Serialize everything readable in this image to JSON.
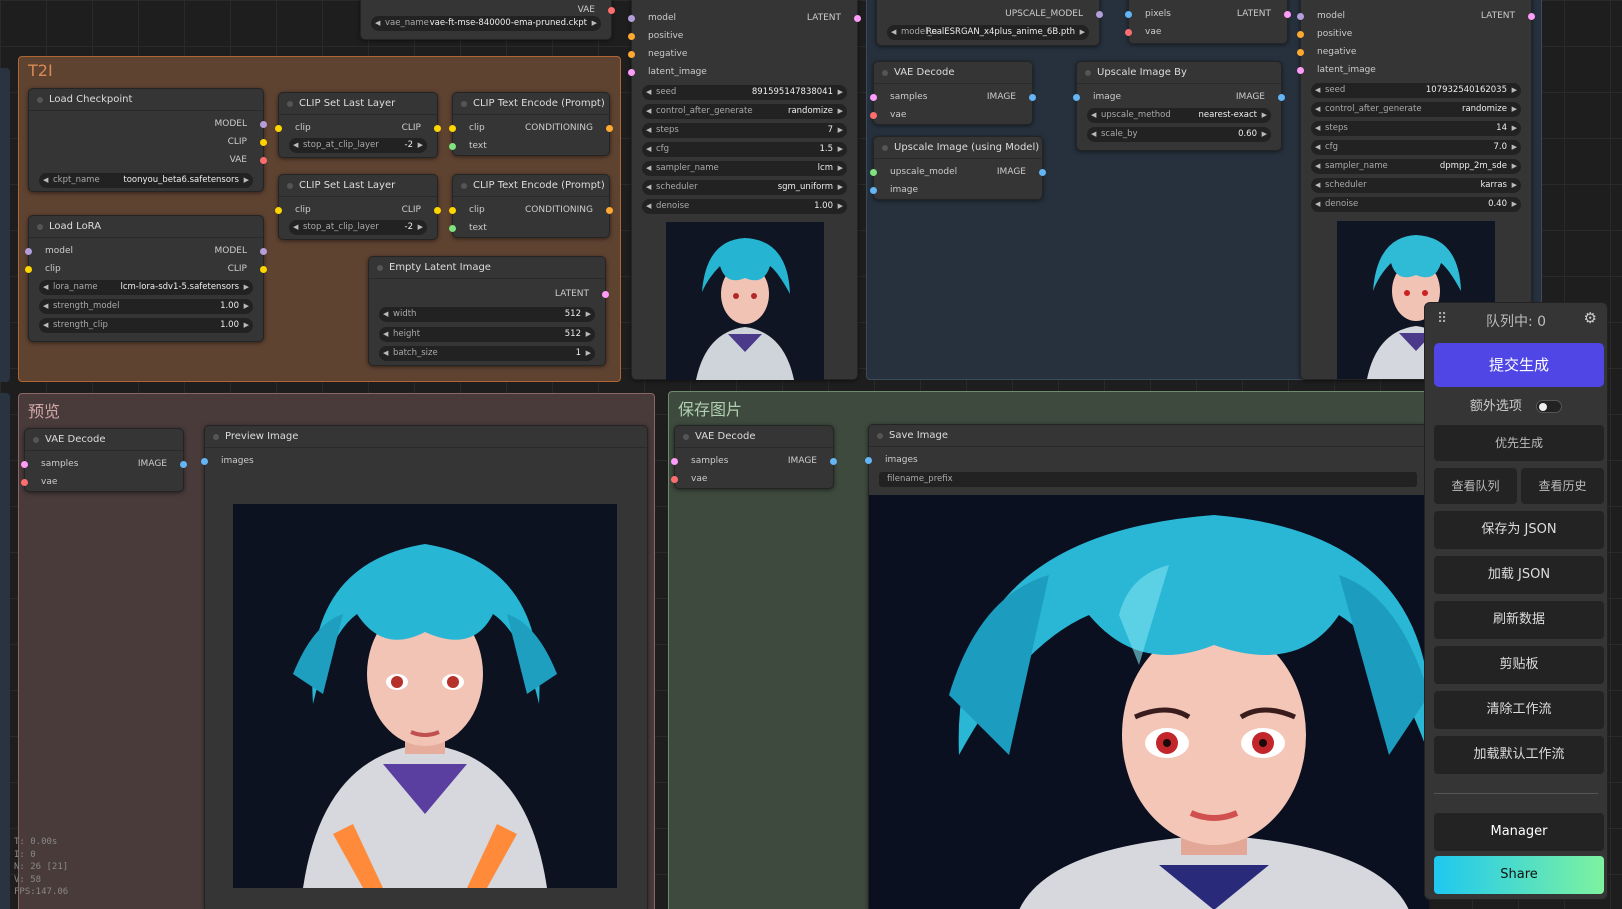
{
  "groups": {
    "t2i": "T2I",
    "preview": "预览",
    "save": "保存图片"
  },
  "vae_loader": {
    "output": "VAE",
    "widget_label": "vae_name",
    "widget_value": "vae-ft-mse-840000-ema-pruned.ckpt"
  },
  "ksampler1": {
    "in_model": "model",
    "in_positive": "positive",
    "in_negative": "negative",
    "in_latent": "latent_image",
    "out": "LATENT",
    "widgets": [
      {
        "l": "seed",
        "v": "891595147838041"
      },
      {
        "l": "control_after_generate",
        "v": "randomize"
      },
      {
        "l": "steps",
        "v": "7"
      },
      {
        "l": "cfg",
        "v": "1.5"
      },
      {
        "l": "sampler_name",
        "v": "lcm"
      },
      {
        "l": "scheduler",
        "v": "sgm_uniform"
      },
      {
        "l": "denoise",
        "v": "1.00"
      }
    ]
  },
  "upscale_loader": {
    "out": "UPSCALE_MODEL",
    "widget_label": "model_n",
    "widget_value": "RealESRGAN_x4plus_anime_6B.pth"
  },
  "vae_encode": {
    "in_pixels": "pixels",
    "in_vae": "vae",
    "out": "LATENT"
  },
  "vae_decode_top": {
    "title": "VAE Decode",
    "in_samples": "samples",
    "in_vae": "vae",
    "out": "IMAGE"
  },
  "upscale_model": {
    "title": "Upscale Image (using Model)",
    "in_model": "upscale_model",
    "in_image": "image",
    "out": "IMAGE"
  },
  "upscale_by": {
    "title": "Upscale Image By",
    "in_image": "image",
    "out": "IMAGE",
    "widgets": [
      {
        "l": "upscale_method",
        "v": "nearest-exact"
      },
      {
        "l": "scale_by",
        "v": "0.60"
      }
    ]
  },
  "ksampler2": {
    "in_model": "model",
    "in_positive": "positive",
    "in_negative": "negative",
    "in_latent": "latent_image",
    "out": "LATENT",
    "widgets": [
      {
        "l": "seed",
        "v": "107932540162035"
      },
      {
        "l": "control_after_generate",
        "v": "randomize"
      },
      {
        "l": "steps",
        "v": "14"
      },
      {
        "l": "cfg",
        "v": "7.0"
      },
      {
        "l": "sampler_name",
        "v": "dpmpp_2m_sde"
      },
      {
        "l": "scheduler",
        "v": "karras"
      },
      {
        "l": "denoise",
        "v": "0.40"
      }
    ]
  },
  "load_checkpoint": {
    "title": "Load Checkpoint",
    "out_model": "MODEL",
    "out_clip": "CLIP",
    "out_vae": "VAE",
    "widget_label": "ckpt_name",
    "widget_value": "toonyou_beta6.safetensors"
  },
  "clip_set1": {
    "title": "CLIP Set Last Layer",
    "in": "clip",
    "out": "CLIP",
    "widget_label": "stop_at_clip_layer",
    "widget_value": "-2"
  },
  "clip_set2": {
    "title": "CLIP Set Last Layer",
    "in": "clip",
    "out": "CLIP",
    "widget_label": "stop_at_clip_layer",
    "widget_value": "-2"
  },
  "clip_text1": {
    "title": "CLIP Text Encode (Prompt)",
    "in_clip": "clip",
    "in_text": "text",
    "out": "CONDITIONING"
  },
  "clip_text2": {
    "title": "CLIP Text Encode (Prompt)",
    "in_clip": "clip",
    "in_text": "text",
    "out": "CONDITIONING"
  },
  "load_lora": {
    "title": "Load LoRA",
    "in_model": "model",
    "in_clip": "clip",
    "out_model": "MODEL",
    "out_clip": "CLIP",
    "widgets": [
      {
        "l": "lora_name",
        "v": "lcm-lora-sdv1-5.safetensors"
      },
      {
        "l": "strength_model",
        "v": "1.00"
      },
      {
        "l": "strength_clip",
        "v": "1.00"
      }
    ]
  },
  "empty_latent": {
    "title": "Empty Latent Image",
    "out": "LATENT",
    "widgets": [
      {
        "l": "width",
        "v": "512"
      },
      {
        "l": "height",
        "v": "512"
      },
      {
        "l": "batch_size",
        "v": "1"
      }
    ]
  },
  "vae_decode_preview": {
    "title": "VAE Decode",
    "in_samples": "samples",
    "in_vae": "vae",
    "out": "IMAGE"
  },
  "preview_image": {
    "title": "Preview Image",
    "in": "images"
  },
  "vae_decode_save": {
    "title": "VAE Decode",
    "in_samples": "samples",
    "in_vae": "vae",
    "out": "IMAGE"
  },
  "save_image": {
    "title": "Save Image",
    "in": "images",
    "widget_label": "filename_prefix"
  },
  "panel": {
    "queue": "队列中: 0",
    "submit": "提交生成",
    "extra": "额外选项",
    "priority": "优先生成",
    "view_queue": "查看队列",
    "view_history": "查看历史",
    "save_json": "保存为 JSON",
    "load_json": "加载 JSON",
    "refresh": "刷新数据",
    "clipboard": "剪贴板",
    "clear": "清除工作流",
    "load_default": "加载默认工作流",
    "manager": "Manager",
    "share": "Share"
  },
  "stats": {
    "t": "T: 0.00s",
    "i": "I: 0",
    "n": "N: 26 [21]",
    "v": "V: 58",
    "fps": "FPS:147.06"
  },
  "colors": {
    "t2i": "#b06634",
    "preview": "#a88",
    "save": "#8a8",
    "canvas": "#1e1e1e",
    "accent": "#4f46e5"
  }
}
